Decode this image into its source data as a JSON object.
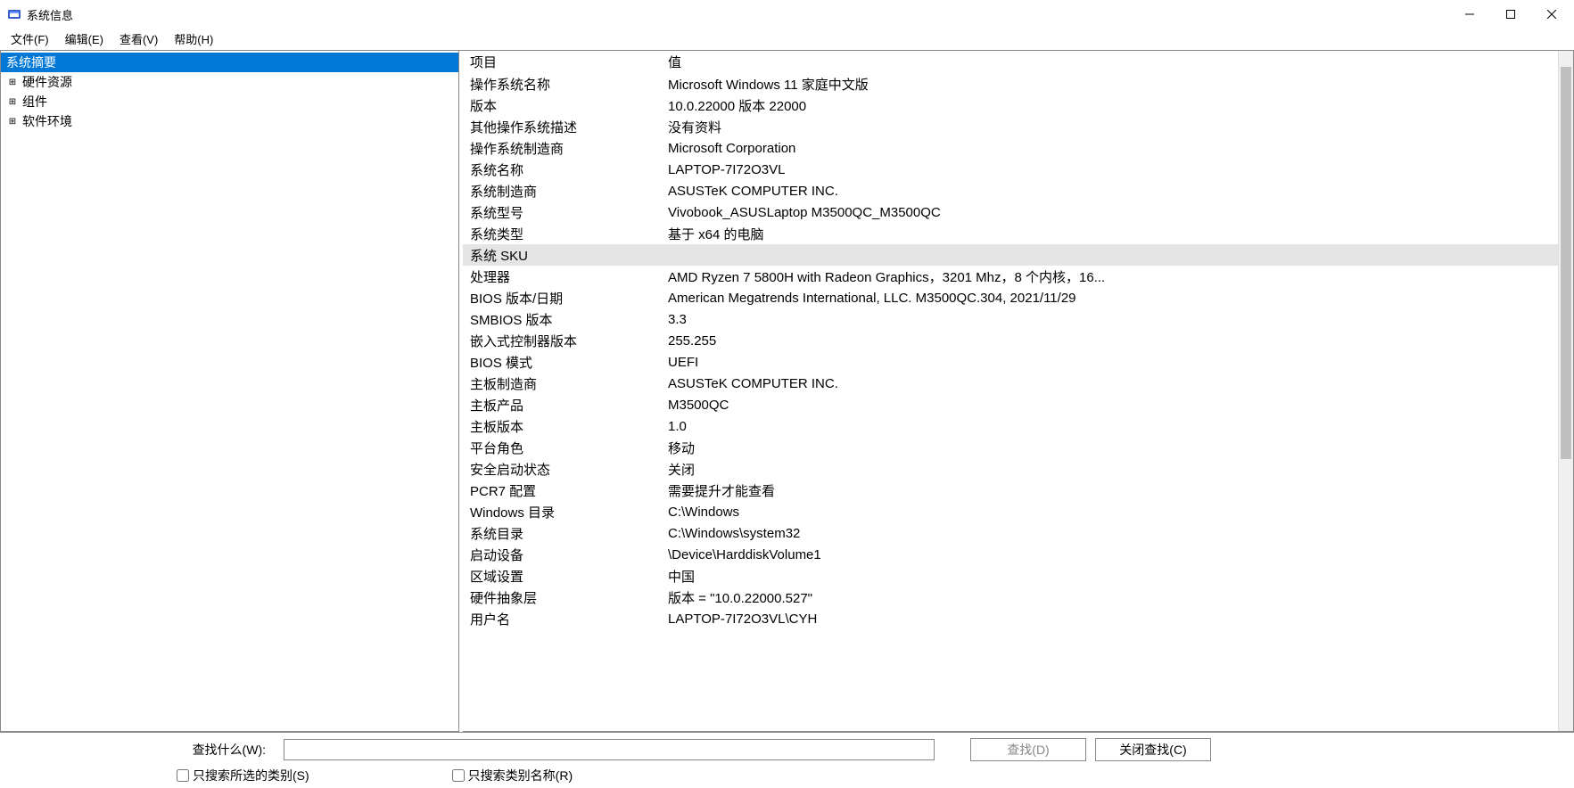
{
  "window": {
    "title": "系统信息"
  },
  "menu": {
    "file": "文件(F)",
    "edit": "编辑(E)",
    "view": "查看(V)",
    "help": "帮助(H)"
  },
  "tree": {
    "root": "系统摘要",
    "children": [
      "硬件资源",
      "组件",
      "软件环境"
    ]
  },
  "table": {
    "headers": {
      "key": "项目",
      "value": "值"
    },
    "rows": [
      {
        "key": "操作系统名称",
        "value": "Microsoft Windows 11 家庭中文版"
      },
      {
        "key": "版本",
        "value": "10.0.22000 版本 22000"
      },
      {
        "key": "其他操作系统描述",
        "value": "没有资料"
      },
      {
        "key": "操作系统制造商",
        "value": "Microsoft Corporation"
      },
      {
        "key": "系统名称",
        "value": "LAPTOP-7I72O3VL"
      },
      {
        "key": "系统制造商",
        "value": "ASUSTeK COMPUTER INC."
      },
      {
        "key": "系统型号",
        "value": "Vivobook_ASUSLaptop M3500QC_M3500QC"
      },
      {
        "key": "系统类型",
        "value": "基于 x64 的电脑"
      },
      {
        "key": "系统 SKU",
        "value": "",
        "selected": true
      },
      {
        "key": "处理器",
        "value": "AMD Ryzen 7 5800H with Radeon Graphics，3201 Mhz，8 个内核，16..."
      },
      {
        "key": "BIOS 版本/日期",
        "value": "American Megatrends International, LLC. M3500QC.304, 2021/11/29"
      },
      {
        "key": "SMBIOS 版本",
        "value": "3.3"
      },
      {
        "key": "嵌入式控制器版本",
        "value": "255.255"
      },
      {
        "key": "BIOS 模式",
        "value": "UEFI"
      },
      {
        "key": "主板制造商",
        "value": "ASUSTeK COMPUTER INC."
      },
      {
        "key": "主板产品",
        "value": "M3500QC"
      },
      {
        "key": "主板版本",
        "value": "1.0"
      },
      {
        "key": "平台角色",
        "value": "移动"
      },
      {
        "key": "安全启动状态",
        "value": "关闭"
      },
      {
        "key": "PCR7 配置",
        "value": "需要提升才能查看"
      },
      {
        "key": "Windows 目录",
        "value": "C:\\Windows"
      },
      {
        "key": "系统目录",
        "value": "C:\\Windows\\system32"
      },
      {
        "key": "启动设备",
        "value": "\\Device\\HarddiskVolume1"
      },
      {
        "key": "区域设置",
        "value": "中国"
      },
      {
        "key": "硬件抽象层",
        "value": "版本 = \"10.0.22000.527\""
      },
      {
        "key": "用户名",
        "value": "LAPTOP-7I72O3VL\\CYH"
      }
    ]
  },
  "search": {
    "label": "查找什么(W):",
    "find_button": "查找(D)",
    "close_button": "关闭查找(C)",
    "only_selected": "只搜索所选的类别(S)",
    "only_category_names": "只搜索类别名称(R)"
  }
}
